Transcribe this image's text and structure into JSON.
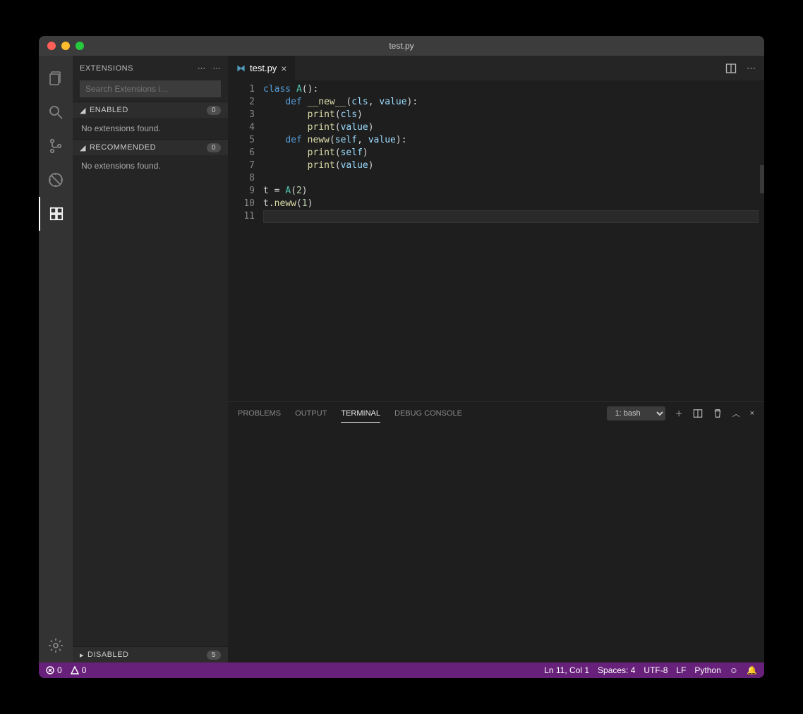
{
  "window": {
    "title": "test.py"
  },
  "sidebar": {
    "title": "Extensions",
    "search_placeholder": "Search Extensions i…",
    "sections": {
      "enabled": {
        "label": "Enabled",
        "count": "0",
        "empty": "No extensions found."
      },
      "recommended": {
        "label": "Recommended",
        "count": "0",
        "empty": "No extensions found."
      },
      "disabled": {
        "label": "Disabled",
        "count": "5"
      }
    }
  },
  "tab": {
    "filename": "test.py"
  },
  "editor": {
    "line_numbers": [
      "1",
      "2",
      "3",
      "4",
      "5",
      "6",
      "7",
      "8",
      "9",
      "10",
      "11"
    ],
    "lines": [
      [
        [
          "kw",
          "class "
        ],
        [
          "cls",
          "A"
        ],
        [
          "pun",
          "():"
        ]
      ],
      [
        [
          "pun",
          "    "
        ],
        [
          "kw",
          "def "
        ],
        [
          "fn",
          "__new__"
        ],
        [
          "pun",
          "("
        ],
        [
          "var",
          "cls"
        ],
        [
          "pun",
          ", "
        ],
        [
          "var",
          "value"
        ],
        [
          "pun",
          "):"
        ]
      ],
      [
        [
          "pun",
          "        "
        ],
        [
          "fn",
          "print"
        ],
        [
          "pun",
          "("
        ],
        [
          "var",
          "cls"
        ],
        [
          "pun",
          ")"
        ]
      ],
      [
        [
          "pun",
          "        "
        ],
        [
          "fn",
          "print"
        ],
        [
          "pun",
          "("
        ],
        [
          "var",
          "value"
        ],
        [
          "pun",
          ")"
        ]
      ],
      [
        [
          "pun",
          "    "
        ],
        [
          "kw",
          "def "
        ],
        [
          "fn",
          "neww"
        ],
        [
          "pun",
          "("
        ],
        [
          "var",
          "self"
        ],
        [
          "pun",
          ", "
        ],
        [
          "var",
          "value"
        ],
        [
          "pun",
          "):"
        ]
      ],
      [
        [
          "pun",
          "        "
        ],
        [
          "fn",
          "print"
        ],
        [
          "pun",
          "("
        ],
        [
          "var",
          "self"
        ],
        [
          "pun",
          ")"
        ]
      ],
      [
        [
          "pun",
          "        "
        ],
        [
          "fn",
          "print"
        ],
        [
          "pun",
          "("
        ],
        [
          "var",
          "value"
        ],
        [
          "pun",
          ")"
        ]
      ],
      [
        [
          "pun",
          ""
        ]
      ],
      [
        [
          "pun",
          "t "
        ],
        [
          "pun",
          "="
        ],
        [
          "pun",
          " "
        ],
        [
          "cls",
          "A"
        ],
        [
          "pun",
          "("
        ],
        [
          "num",
          "2"
        ],
        [
          "pun",
          ")"
        ]
      ],
      [
        [
          "pun",
          "t."
        ],
        [
          "fn",
          "neww"
        ],
        [
          "pun",
          "("
        ],
        [
          "num",
          "1"
        ],
        [
          "pun",
          ")"
        ]
      ],
      [
        [
          "pun",
          ""
        ]
      ]
    ]
  },
  "panel": {
    "tabs": {
      "problems": "Problems",
      "output": "Output",
      "terminal": "Terminal",
      "debug": "Debug Console"
    },
    "terminal_selector": "1: bash"
  },
  "statusbar": {
    "errors": "0",
    "warnings": "0",
    "lncol": "Ln 11, Col 1",
    "spaces": "Spaces: 4",
    "encoding": "UTF-8",
    "eol": "LF",
    "lang": "Python"
  }
}
